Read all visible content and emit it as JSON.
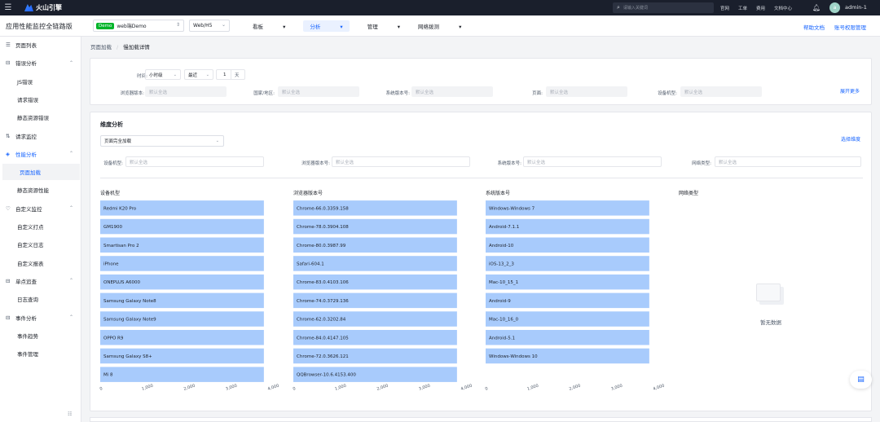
{
  "topbar": {
    "brand": "火山引擎",
    "search_placeholder": "请输入关键词",
    "links": [
      "官网",
      "工单",
      "费用",
      "文档中心"
    ],
    "avatar_letter": "a",
    "user": "admin-1"
  },
  "subbar": {
    "app_title": "应用性能监控全链路版",
    "app_badge": "Demo",
    "app_name": "web端Demo",
    "platform": "Web/H5",
    "nav": [
      {
        "label": "看板",
        "active": false
      },
      {
        "label": "分析",
        "active": true
      },
      {
        "label": "管理",
        "active": false
      },
      {
        "label": "网络拨测",
        "active": false
      }
    ],
    "help": "帮助文档",
    "perm": "账号权限管理"
  },
  "sidebar": {
    "items": [
      {
        "label": "页面列表",
        "icon": "list-icon",
        "glyph": "☰",
        "type": "top",
        "chev": ""
      },
      {
        "label": "错误分析",
        "icon": "error-icon",
        "glyph": "⊟",
        "type": "group",
        "chev": "^"
      },
      {
        "label": "JS错误",
        "type": "sub"
      },
      {
        "label": "请求错误",
        "type": "sub"
      },
      {
        "label": "静态资源错误",
        "type": "sub"
      },
      {
        "label": "请求监控",
        "icon": "request-icon",
        "glyph": "⇅",
        "type": "top",
        "chev": ""
      },
      {
        "label": "性能分析",
        "icon": "performance-icon",
        "glyph": "◈",
        "type": "group-active",
        "chev": "^"
      },
      {
        "label": "页面加载",
        "type": "sub-selected"
      },
      {
        "label": "静态资源性能",
        "type": "sub"
      },
      {
        "label": "自定义监控",
        "icon": "custom-monitor-icon",
        "glyph": "♡",
        "type": "group",
        "chev": "^"
      },
      {
        "label": "自定义打点",
        "type": "sub"
      },
      {
        "label": "自定义日志",
        "type": "sub"
      },
      {
        "label": "自定义报表",
        "type": "sub"
      },
      {
        "label": "单点追查",
        "icon": "trace-icon",
        "glyph": "⊟",
        "type": "group",
        "chev": "^"
      },
      {
        "label": "日志查询",
        "type": "sub"
      },
      {
        "label": "事件分析",
        "icon": "event-icon",
        "glyph": "⊟",
        "type": "group",
        "chev": "^"
      },
      {
        "label": "事件趋势",
        "type": "sub"
      },
      {
        "label": "事件管理",
        "type": "sub"
      }
    ],
    "collapse_icon": "collapse-icon"
  },
  "breadcrumb": {
    "parent": "页面加载",
    "current": "慢加载详情"
  },
  "filter": {
    "time_label": "时间:",
    "granularity": "小时级",
    "range": "最近",
    "count": "1",
    "unit": "天",
    "fields": [
      {
        "label": "浏览器版本:",
        "placeholder": "默认全选"
      },
      {
        "label": "国家/地区:",
        "placeholder": "默认全选"
      },
      {
        "label": "系统版本号:",
        "placeholder": "默认全选"
      },
      {
        "label": "页面:",
        "placeholder": "默认全选"
      },
      {
        "label": "设备机型:",
        "placeholder": "默认全选"
      }
    ],
    "expand": "展开更多"
  },
  "dimension": {
    "title": "维度分析",
    "metric": "页面完全加载",
    "pick": "选择维度",
    "fields": [
      {
        "label": "设备机型:",
        "placeholder": "默认全选"
      },
      {
        "label": "浏览器版本号:",
        "placeholder": "默认全选"
      },
      {
        "label": "系统版本号:",
        "placeholder": "默认全选"
      },
      {
        "label": "网络类型:",
        "placeholder": "默认全选"
      }
    ],
    "empty_title": "网络类型",
    "empty_text": "暂无数据"
  },
  "chart_data": [
    {
      "type": "bar",
      "orientation": "horizontal",
      "title": "设备机型",
      "categories": [
        "Redmi K20 Pro",
        "GM1900",
        "Smartisan Pro 2",
        "iPhone",
        "ONEPLUS A6000",
        "Samsung Galaxy Note8",
        "Samsung Galaxy Note9",
        "OPPO R9",
        "Samsung Galaxy S8+",
        "Mi 8"
      ],
      "values": [
        3900,
        3900,
        3900,
        3900,
        3900,
        3900,
        3900,
        3900,
        3900,
        3900
      ],
      "xlim": [
        0,
        4000
      ],
      "ticks": [
        "0",
        "1,000",
        "2,000",
        "3,000",
        "4,000"
      ],
      "color": "#a8cbfc"
    },
    {
      "type": "bar",
      "orientation": "horizontal",
      "title": "浏览器版本号",
      "categories": [
        "Chrome-66.0.3359.158",
        "Chrome-78.0.3904.108",
        "Chrome-80.0.3987.99",
        "Safari-604.1",
        "Chrome-83.0.4103.106",
        "Chrome-74.0.3729.136",
        "Chrome-62.0.3202.84",
        "Chrome-84.0.4147.105",
        "Chrome-72.0.3626.121",
        "QQBrowser-10.6.4153.400"
      ],
      "values": [
        3900,
        3900,
        3900,
        3900,
        3900,
        3900,
        3900,
        3900,
        3900,
        3900
      ],
      "xlim": [
        0,
        4000
      ],
      "ticks": [
        "0",
        "1,000",
        "2,000",
        "3,000",
        "4,000"
      ],
      "color": "#a8cbfc"
    },
    {
      "type": "bar",
      "orientation": "horizontal",
      "title": "系统版本号",
      "categories": [
        "Windows-Windows 7",
        "Android-7.1.1",
        "Android-10",
        "iOS-13_2_3",
        "Mac-10_15_1",
        "Android-9",
        "Mac-10_16_0",
        "Android-5.1",
        "Windows-Windows 10"
      ],
      "values": [
        3900,
        3900,
        3900,
        3900,
        3900,
        3900,
        3900,
        3900,
        3900
      ],
      "xlim": [
        0,
        4000
      ],
      "ticks": [
        "0",
        "1,000",
        "2,000",
        "3,000",
        "4,000"
      ],
      "color": "#a8cbfc"
    }
  ]
}
